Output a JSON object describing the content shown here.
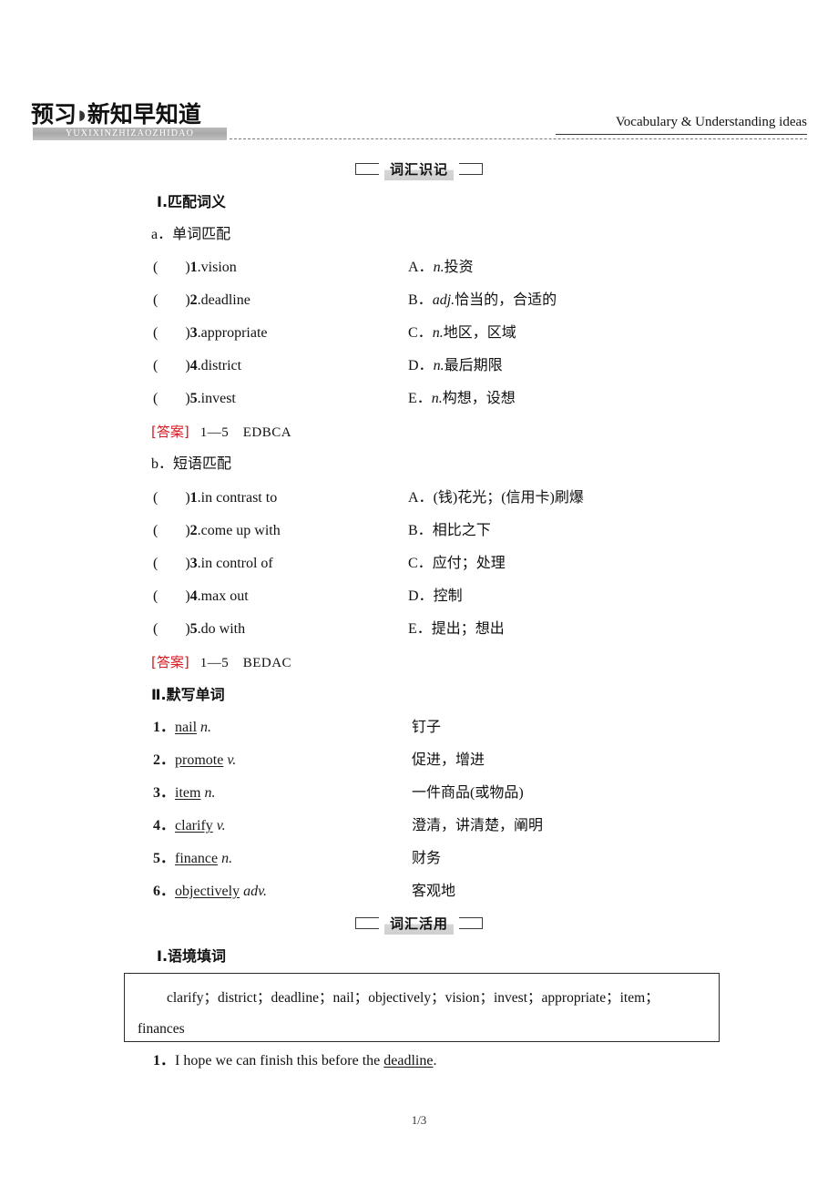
{
  "banner": {
    "title_left": "预习",
    "arrow": "◗",
    "title_right": "新知早知道",
    "pinyin": "YUXIXINZHIZAOZHIDAO",
    "right_label": "Vocabulary & Understanding ideas"
  },
  "sections": {
    "memorize": "词汇识记",
    "apply": "词汇活用"
  },
  "part1": {
    "heading": "Ⅰ.匹配词义",
    "group_a": {
      "label": "a．单词匹配",
      "items": [
        {
          "num": "1",
          "word": "vision"
        },
        {
          "num": "2",
          "word": "deadline"
        },
        {
          "num": "3",
          "word": "appropriate"
        },
        {
          "num": "4",
          "word": "district"
        },
        {
          "num": "5",
          "word": "invest"
        }
      ],
      "options": [
        {
          "letter": "A．",
          "pos": "n.",
          "def": "投资"
        },
        {
          "letter": "B．",
          "pos": "adj.",
          "def": "恰当的，合适的"
        },
        {
          "letter": "C．",
          "pos": "n.",
          "def": "地区，区域"
        },
        {
          "letter": "D．",
          "pos": "n.",
          "def": "最后期限"
        },
        {
          "letter": "E．",
          "pos": "n.",
          "def": "构想，设想"
        }
      ],
      "answer_tag": "[答案]",
      "answer_value": "1—5　EDBCA"
    },
    "group_b": {
      "label": "b．短语匹配",
      "items": [
        {
          "num": "1",
          "word": "in contrast to"
        },
        {
          "num": "2",
          "word": "come up with"
        },
        {
          "num": "3",
          "word": "in control of"
        },
        {
          "num": "4",
          "word": "max out"
        },
        {
          "num": "5",
          "word": "do with"
        }
      ],
      "options": [
        {
          "letter": "A．",
          "pos": "",
          "def": "(钱)花光；(信用卡)刷爆"
        },
        {
          "letter": "B．",
          "pos": "",
          "def": "相比之下"
        },
        {
          "letter": "C．",
          "pos": "",
          "def": "应付；处理"
        },
        {
          "letter": "D．",
          "pos": "",
          "def": "控制"
        },
        {
          "letter": "E．",
          "pos": "",
          "def": "提出；想出"
        }
      ],
      "answer_tag": "[答案]",
      "answer_value": "1—5　BEDAC"
    }
  },
  "part2": {
    "heading": "Ⅱ.默写单词",
    "rows": [
      {
        "num": "1．",
        "word": "nail",
        "pos": "n.",
        "meaning": "钉子"
      },
      {
        "num": "2．",
        "word": "promote",
        "pos": "v.",
        "meaning": "促进，增进"
      },
      {
        "num": "3．",
        "word": "item",
        "pos": "n.",
        "meaning": "一件商品(或物品)"
      },
      {
        "num": "4．",
        "word": "clarify",
        "pos": "v.",
        "meaning": "澄清，讲清楚，阐明"
      },
      {
        "num": "5．",
        "word": "finance",
        "pos": "n.",
        "meaning": "财务"
      },
      {
        "num": "6．",
        "word": "objectively",
        "pos": "adv.",
        "meaning": "客观地"
      }
    ]
  },
  "part3": {
    "heading": "Ⅰ.语境填词",
    "word_bank_line1": "clarify；district；deadline；nail；objectively；vision；invest；appropriate；",
    "word_bank_line2": "item；finances",
    "sentence_num": "1．",
    "sentence_before": "I hope we can finish this before the ",
    "sentence_answer": "deadline",
    "sentence_after": "."
  },
  "footer": {
    "page_number": "1/3"
  }
}
